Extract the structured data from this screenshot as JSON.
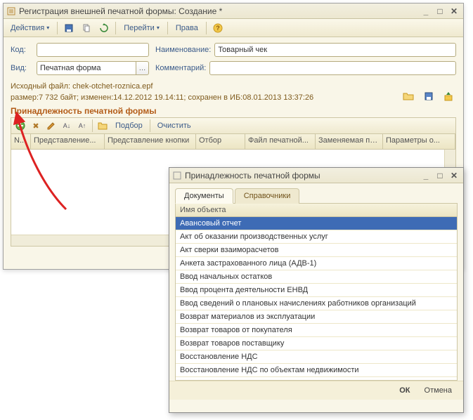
{
  "main": {
    "title": "Регистрация внешней печатной формы: Создание *",
    "toolbar": {
      "actions": "Действия",
      "goto": "Перейти",
      "rights": "Права"
    },
    "form": {
      "labels": {
        "code": "Код:",
        "name": "Наименование:",
        "kind": "Вид:",
        "comment": "Комментарий:"
      },
      "code": "",
      "name": "Товарный чек",
      "kind": "Печатная форма",
      "comment": ""
    },
    "info": "Исходный файл: chek-otchet-roznica.epf",
    "info2": "размер:7 732 байт; изменен:14.12.2012 19.14:11; сохранен в ИБ:08.01.2013 13:37:26",
    "section": "Принадлежность печатной формы",
    "gridtb": {
      "select": "Подбор",
      "clear": "Очистить"
    },
    "columns": [
      "N...",
      "Представление...",
      "Представление кнопки",
      "Отбор",
      "Файл печатной...",
      "Заменяемая пе...",
      "Параметры о..."
    ]
  },
  "dialog": {
    "title": "Принадлежность печатной формы",
    "tabs": {
      "docs": "Документы",
      "refs": "Справочники"
    },
    "header": "Имя объекта",
    "items": [
      "Авансовый отчет",
      "Акт об оказании производственных услуг",
      "Акт сверки взаиморасчетов",
      "Анкета застрахованного лица (АДВ-1)",
      "Ввод начальных остатков",
      "Ввод процента деятельности ЕНВД",
      "Ввод сведений о плановых начислениях работников организаций",
      "Возврат материалов из эксплуатации",
      "Возврат товаров от покупателя",
      "Возврат товаров поставщику",
      "Восстановление НДС",
      "Восстановление НДС по объектам недвижимости"
    ],
    "buttons": {
      "ok": "ОК",
      "cancel": "Отмена"
    }
  }
}
